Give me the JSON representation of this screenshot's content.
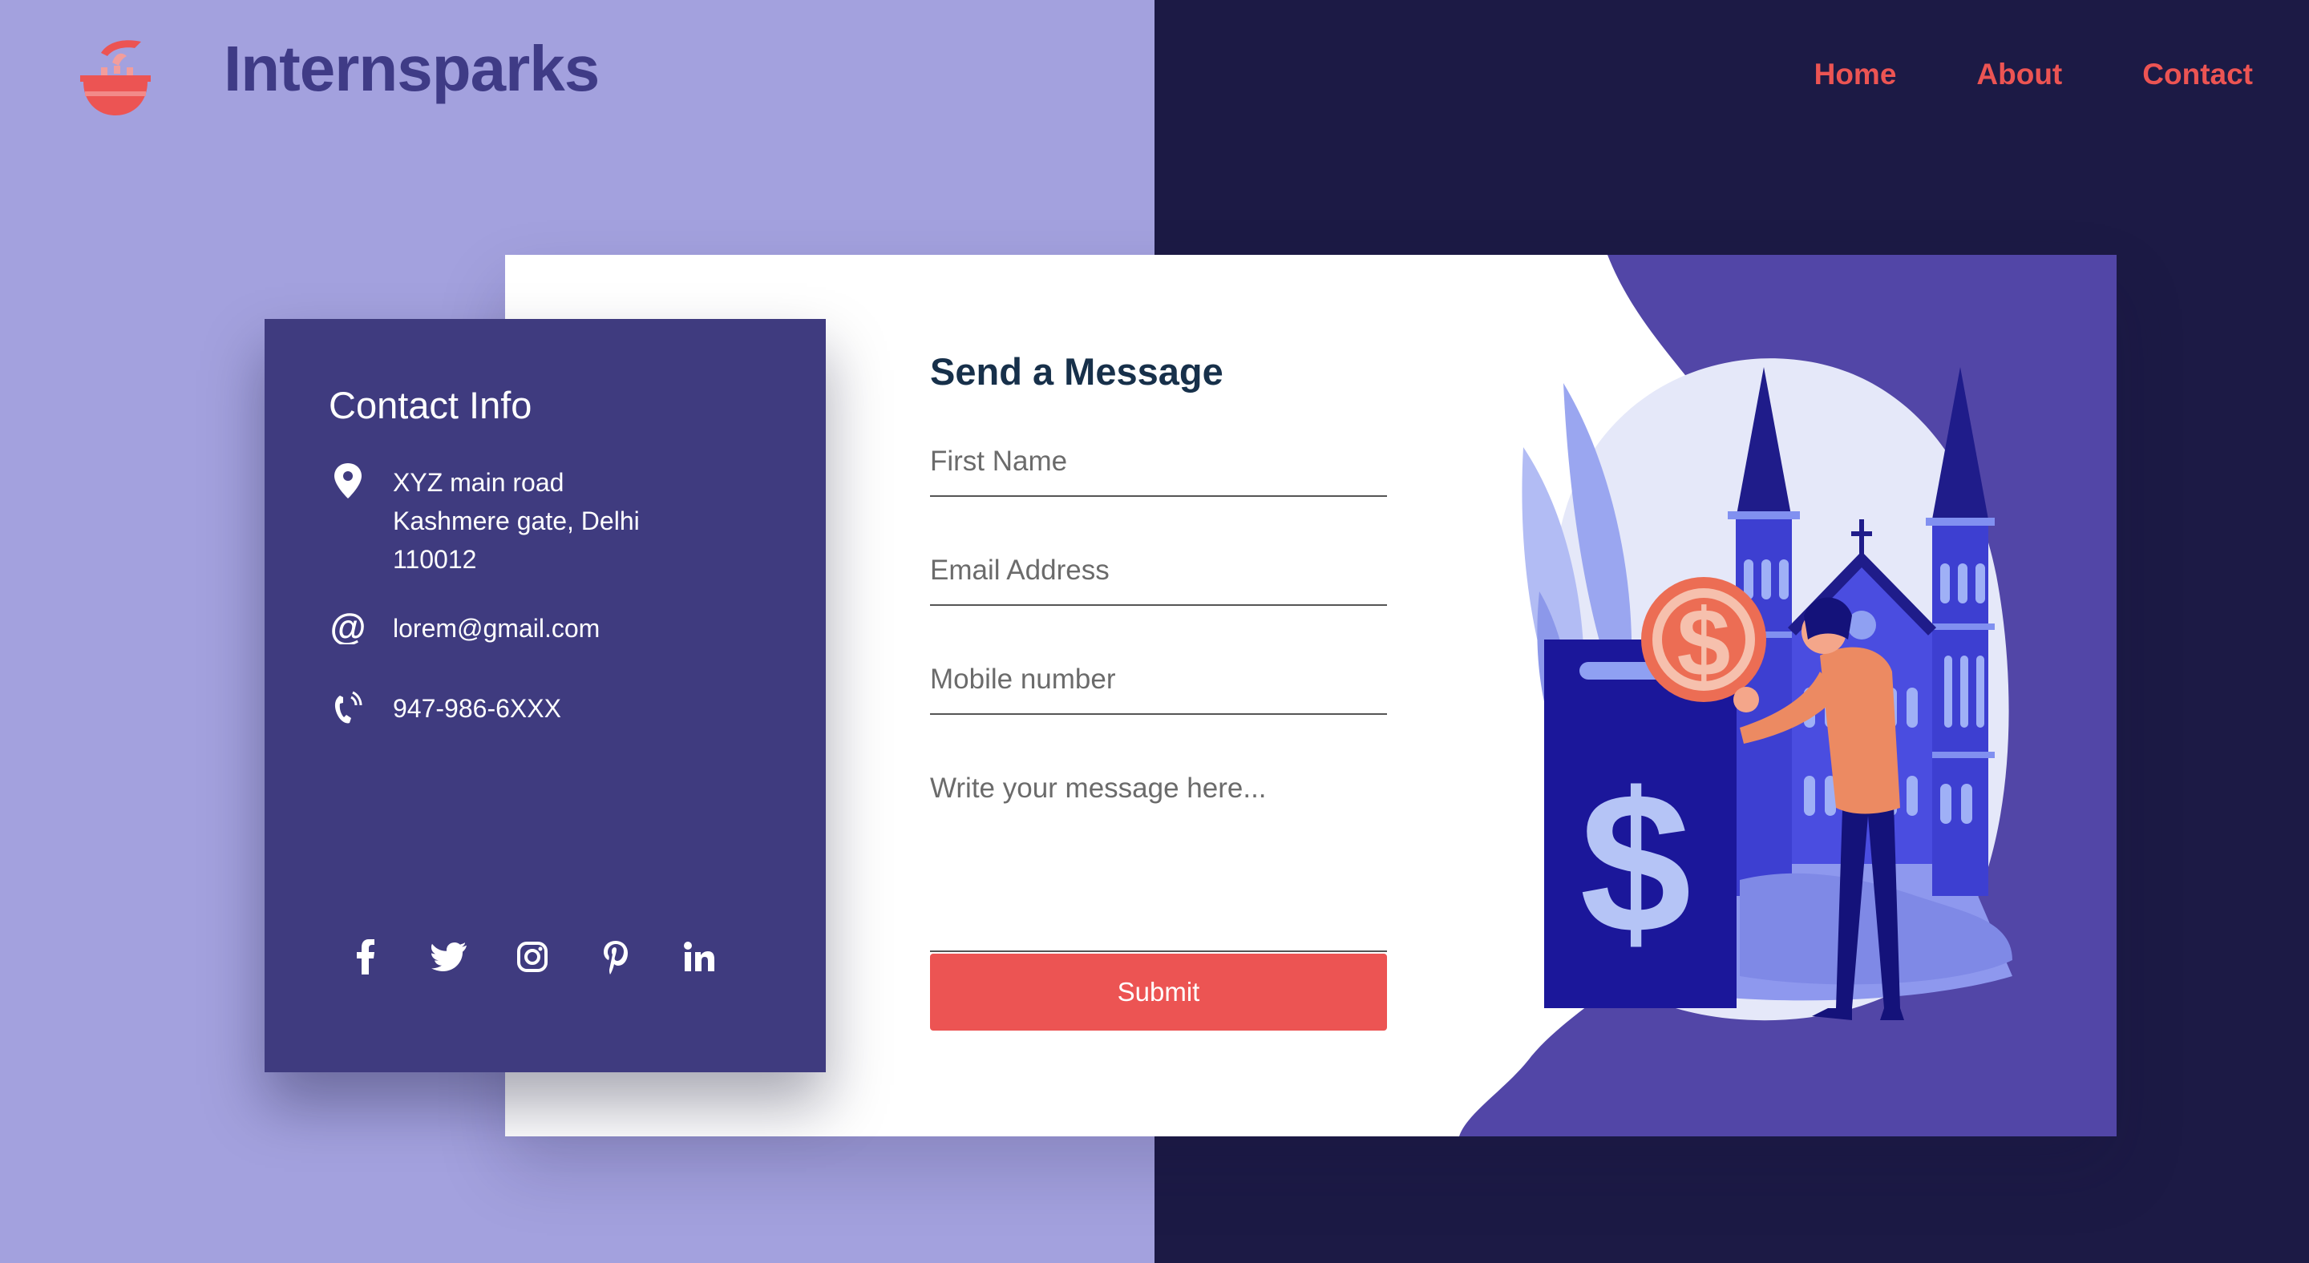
{
  "header": {
    "brand": "Internsparks",
    "logo_icon": "cooking-pot-icon",
    "nav": [
      {
        "label": "Home"
      },
      {
        "label": "About"
      },
      {
        "label": "Contact"
      }
    ]
  },
  "contact_info": {
    "title": "Contact Info",
    "address_line1": "XYZ main road",
    "address_line2": "Kashmere gate, Delhi",
    "address_line3": "110012",
    "email": "lorem@gmail.com",
    "phone": "947-986-6XXX",
    "icons": [
      "location-pin-icon",
      "at-sign-icon",
      "phone-icon"
    ],
    "social": [
      "facebook-icon",
      "twitter-icon",
      "instagram-icon",
      "pinterest-icon",
      "linkedin-icon"
    ]
  },
  "form": {
    "title": "Send a Message",
    "first_name_placeholder": "First Name",
    "email_placeholder": "Email Address",
    "mobile_placeholder": "Mobile number",
    "message_placeholder": "Write your message here...",
    "submit_label": "Submit"
  },
  "colors": {
    "left_bg": "#a3a1de",
    "right_bg": "#1c1a45",
    "panel": "#3f3b7f",
    "accent": "#ec5453",
    "brand_text": "#3f3b86"
  }
}
